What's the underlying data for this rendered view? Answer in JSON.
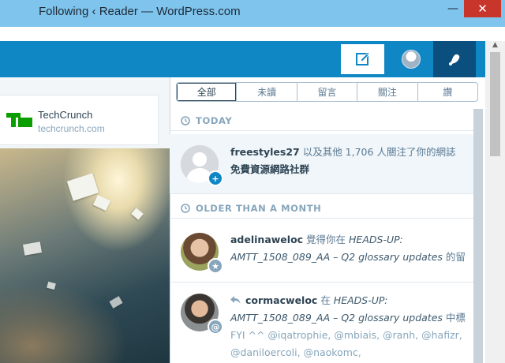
{
  "window": {
    "title": "Following ‹ Reader — WordPress.com",
    "minimize_glyph": "—",
    "close_glyph": "✕"
  },
  "masterbar": {
    "write_icon": "edit-icon",
    "me_icon": "avatar-icon",
    "notifications_icon": "bell-icon"
  },
  "site_card": {
    "name": "TechCrunch",
    "url": "techcrunch.com"
  },
  "filters": {
    "tabs": [
      {
        "label": "全部",
        "active": true
      },
      {
        "label": "未讀",
        "active": false
      },
      {
        "label": "留言",
        "active": false
      },
      {
        "label": "關注",
        "active": false
      },
      {
        "label": "讚",
        "active": false
      }
    ]
  },
  "sections": {
    "today": "TODAY",
    "older": "OLDER THAN A MONTH"
  },
  "notifications": [
    {
      "user": "freestyles27",
      "text_a": " 以及其他 1,706 人關注了你的網誌 ",
      "text_b": "免費資源網路社群",
      "badge_icon": "follow-plus-icon"
    },
    {
      "user": "adelinaweloc",
      "text_a": " 覺得你在 ",
      "text_b": "HEADS-UP: AMTT_1508_089_AA – Q2 glossary updates",
      "text_c": " 的留",
      "badge_icon": "star-icon"
    },
    {
      "user": "cormacweloc",
      "text_a": " 在 ",
      "text_b": "HEADS-UP: AMTT_1508_089_AA – Q2 glossary updates",
      "text_c": " 中標",
      "text_d": "FYI ^^ @iqatrophie, @mbiais, @ranh, @hafizr, @daniloercoli, @naokomc,",
      "badge_icon": "at-icon"
    }
  ]
}
